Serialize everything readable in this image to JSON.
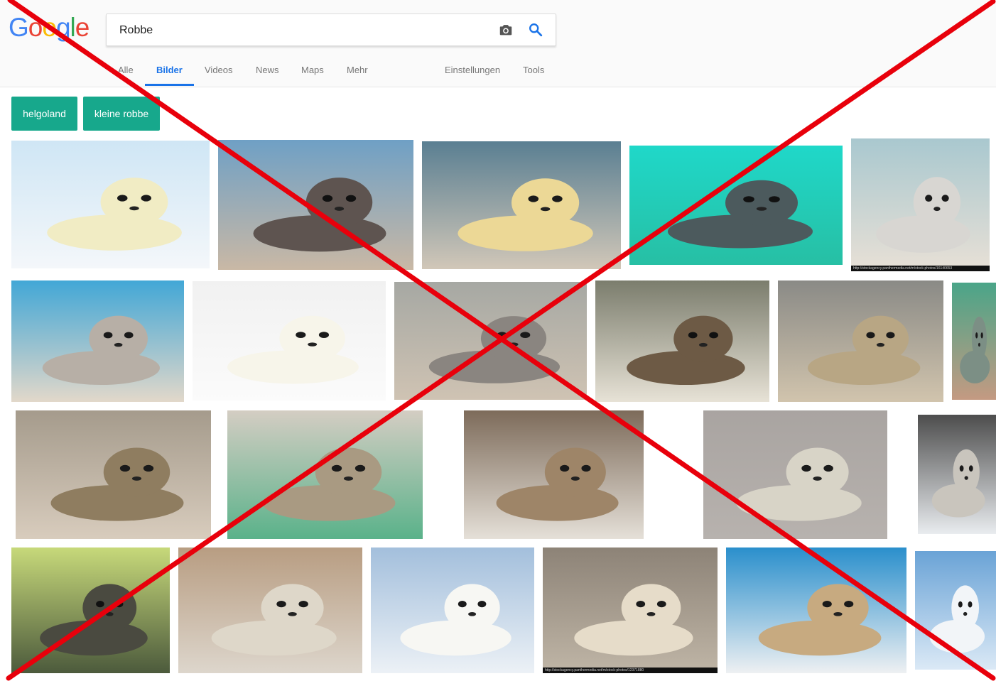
{
  "logo": {
    "letters": [
      "G",
      "o",
      "o",
      "g",
      "l",
      "e"
    ],
    "colors": [
      "#4285f4",
      "#ea4335",
      "#fbbc05",
      "#4285f4",
      "#34a853",
      "#ea4335"
    ]
  },
  "search": {
    "value": "Robbe"
  },
  "tabs": [
    {
      "label": "Alle"
    },
    {
      "label": "Bilder",
      "active": true
    },
    {
      "label": "Videos"
    },
    {
      "label": "News"
    },
    {
      "label": "Maps"
    },
    {
      "label": "Mehr"
    }
  ],
  "tools": {
    "settings_label": "Einstellungen",
    "tools_label": "Tools"
  },
  "chips": [
    {
      "label": "helgoland"
    },
    {
      "label": "kleine robbe"
    }
  ],
  "accent_colors": {
    "chip": "#17a88c",
    "tab_active": "#1a73e8",
    "cross": "#e8000b"
  },
  "images": [
    {
      "bg": [
        "#cfe6f5",
        "#f4f7fa"
      ],
      "body": "#f1ecc4",
      "dark": false,
      "credit": ""
    },
    {
      "bg": [
        "#6fa0c5",
        "#c9b8a5"
      ],
      "body": "#5e5450",
      "dark": true,
      "credit": ""
    },
    {
      "bg": [
        "#5a7f92",
        "#d1c7b8"
      ],
      "body": "#ecd896",
      "dark": false,
      "credit": ""
    },
    {
      "bg": [
        "#1fd8c9",
        "#27bfa4"
      ],
      "body": "#4c5a5d",
      "dark": true,
      "credit": ""
    },
    {
      "bg": [
        "#a9c8cf",
        "#e8e0d6"
      ],
      "body": "#d8d6d2",
      "dark": false,
      "credit": "http://stockagency.panthermedia.net/m/stock-photos/16140653"
    },
    {
      "bg": [
        "#42a7d6",
        "#e2d8ca"
      ],
      "body": "#b7afa6",
      "dark": false,
      "credit": ""
    },
    {
      "bg": [
        "#f1f1f1",
        "#fbfbfb"
      ],
      "body": "#f7f5ea",
      "dark": false,
      "credit": ""
    },
    {
      "bg": [
        "#a6a8a3",
        "#cfc3b3"
      ],
      "body": "#8a8580",
      "dark": false,
      "credit": ""
    },
    {
      "bg": [
        "#7b7d6d",
        "#e7e2d6"
      ],
      "body": "#6d5a45",
      "dark": true,
      "credit": ""
    },
    {
      "bg": [
        "#8a8a86",
        "#d1c4ad"
      ],
      "body": "#b8a684",
      "dark": false,
      "credit": ""
    },
    {
      "bg": [
        "#4aa588",
        "#c49a82"
      ],
      "body": "#7c8f85",
      "dark": false,
      "credit": ""
    },
    {
      "bg": [
        "#a59b8c",
        "#d8ccbd"
      ],
      "body": "#8f7d60",
      "dark": false,
      "credit": ""
    },
    {
      "bg": [
        "#d4cdc3",
        "#5ab28a"
      ],
      "body": "#a99a82",
      "dark": false,
      "credit": ""
    },
    {
      "bg": [
        "#7d6b5a",
        "#e5e0d8"
      ],
      "body": "#9e8568",
      "dark": false,
      "credit": ""
    },
    {
      "bg": [
        "#a9a4a1",
        "#b7b2ae"
      ],
      "body": "#d8d4c7",
      "dark": false,
      "credit": ""
    },
    {
      "bg": [
        "#4d4d4d",
        "#e9ecef"
      ],
      "body": "#c9c5bd",
      "dark": false,
      "credit": ""
    },
    {
      "bg": [
        "#c7d97a",
        "#4c5a3c"
      ],
      "body": "#4a4a40",
      "dark": true,
      "credit": ""
    },
    {
      "bg": [
        "#b89d82",
        "#ddd6cc"
      ],
      "body": "#ded7c9",
      "dark": false,
      "credit": ""
    },
    {
      "bg": [
        "#a3bfdc",
        "#ecf1f6"
      ],
      "body": "#f7f7f3",
      "dark": false,
      "credit": ""
    },
    {
      "bg": [
        "#8d8377",
        "#bfb5a6"
      ],
      "body": "#e6dcc9",
      "dark": false,
      "credit": "http://stockagency.panthermedia.net/m/stock-photos/12371880"
    },
    {
      "bg": [
        "#2a8fcc",
        "#eef0f2"
      ],
      "body": "#c7aa80",
      "dark": false,
      "credit": ""
    },
    {
      "bg": [
        "#6aa3d6",
        "#dbe9f6"
      ],
      "body": "#f2f5f8",
      "dark": false,
      "credit": ""
    }
  ]
}
